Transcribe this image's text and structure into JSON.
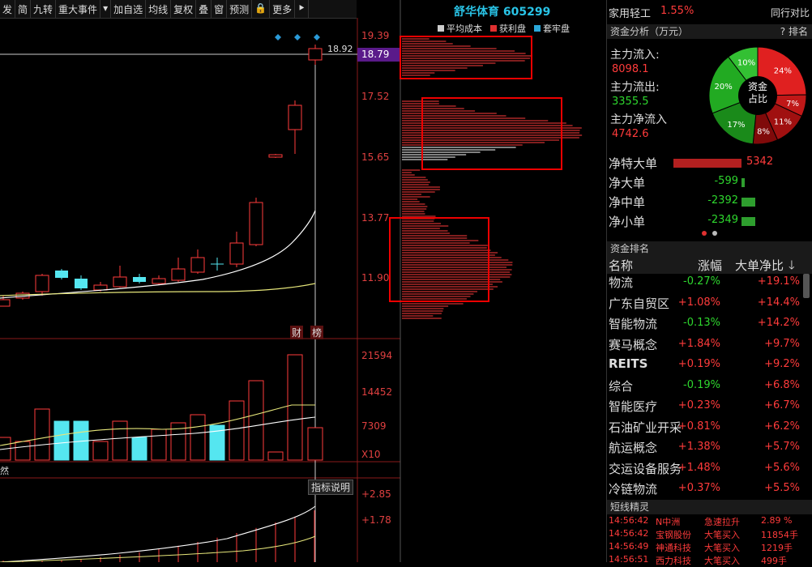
{
  "toolbar": {
    "items": [
      "发",
      "简",
      "九转",
      "重大事件",
      "▾",
      "加自选",
      "均线",
      "复权",
      "叠",
      "窗",
      "预测",
      "🔒",
      "更多",
      "⯈"
    ]
  },
  "kline": {
    "price_labels": [
      "19.39",
      "18.79",
      "17.52",
      "15.65",
      "13.77",
      "11.90"
    ],
    "current_price_marker": "18.92",
    "badge_cai": "财",
    "badge_bang": "榜"
  },
  "volume": {
    "labels": [
      "21594",
      "14452",
      "7309",
      "X10"
    ]
  },
  "indicator": {
    "labels": [
      "+2.85",
      "+1.78"
    ],
    "tab_label": "指标说明",
    "left_tab": "然"
  },
  "chip": {
    "title": "舒华体育 605299",
    "legend": [
      {
        "label": "平均成本",
        "color": "#cccccc"
      },
      {
        "label": "获利盘",
        "color": "#e03030"
      },
      {
        "label": "套牢盘",
        "color": "#2aa7d8"
      }
    ]
  },
  "sector": {
    "name": "家用轻工",
    "change": "1.55%",
    "compare": "同行对比"
  },
  "fund": {
    "header": "资金分析（万元）",
    "rank_btn": "排名",
    "inflow_label": "主力流入:",
    "inflow_value": "8098.1",
    "outflow_label": "主力流出:",
    "outflow_value": "3355.5",
    "net_label": "主力净流入",
    "net_value": "4742.6",
    "donut_center_1": "资金",
    "donut_center_2": "占比",
    "donut": [
      {
        "label": "24%",
        "value": 24,
        "color": "#e02020"
      },
      {
        "label": "7%",
        "value": 7,
        "color": "#c01818"
      },
      {
        "label": "11%",
        "value": 11,
        "color": "#a01010"
      },
      {
        "label": "8%",
        "value": 8,
        "color": "#800a0a"
      },
      {
        "label": "17%",
        "value": 17,
        "color": "#1a8a1a"
      },
      {
        "label": "20%",
        "value": 20,
        "color": "#22aa22"
      },
      {
        "label": "10%",
        "value": 10,
        "color": "#33c033"
      }
    ],
    "bars": [
      {
        "label": "净特大单",
        "value": 5342,
        "display": "5342"
      },
      {
        "label": "净大单",
        "value": -599,
        "display": "-599"
      },
      {
        "label": "净中单",
        "value": -2392,
        "display": "-2392"
      },
      {
        "label": "净小单",
        "value": -2349,
        "display": "-2349"
      }
    ]
  },
  "ranking": {
    "header": "资金排名",
    "columns": [
      "名称",
      "涨幅",
      "大单净比"
    ],
    "rows": [
      {
        "name": "物流",
        "chg": "-0.27%",
        "net": "+19.1%"
      },
      {
        "name": "广东自贸区",
        "chg": "+1.08%",
        "net": "+14.4%"
      },
      {
        "name": "智能物流",
        "chg": "-0.13%",
        "net": "+14.2%"
      },
      {
        "name": "赛马概念",
        "chg": "+1.84%",
        "net": "+9.7%"
      },
      {
        "name": "REITS",
        "chg": "+0.19%",
        "net": "+9.2%"
      },
      {
        "name": "综合",
        "chg": "-0.19%",
        "net": "+6.8%"
      },
      {
        "name": "智能医疗",
        "chg": "+0.23%",
        "net": "+6.7%"
      },
      {
        "name": "石油矿业开采",
        "chg": "+0.81%",
        "net": "+6.2%"
      },
      {
        "name": "航运概念",
        "chg": "+1.38%",
        "net": "+5.7%"
      },
      {
        "name": "交运设备服务",
        "chg": "+1.48%",
        "net": "+5.6%"
      },
      {
        "name": "冷链物流",
        "chg": "+0.37%",
        "net": "+5.5%"
      }
    ]
  },
  "feed": {
    "header": "短线精灵",
    "rows": [
      {
        "time": "14:56:42",
        "stock": "N中洲",
        "event": "急速拉升",
        "val": "2.89 %"
      },
      {
        "time": "14:56:42",
        "stock": "宝钢股份",
        "event": "大笔买入",
        "val": "11854手"
      },
      {
        "time": "14:56:49",
        "stock": "神通科技",
        "event": "大笔买入",
        "val": "1219手"
      },
      {
        "time": "14:56:51",
        "stock": "西力科技",
        "event": "大笔买入",
        "val": "499手"
      }
    ]
  },
  "colors": {
    "up": "#ff3b3b",
    "down": "#2ed72e",
    "cyan": "#55e6f0"
  }
}
